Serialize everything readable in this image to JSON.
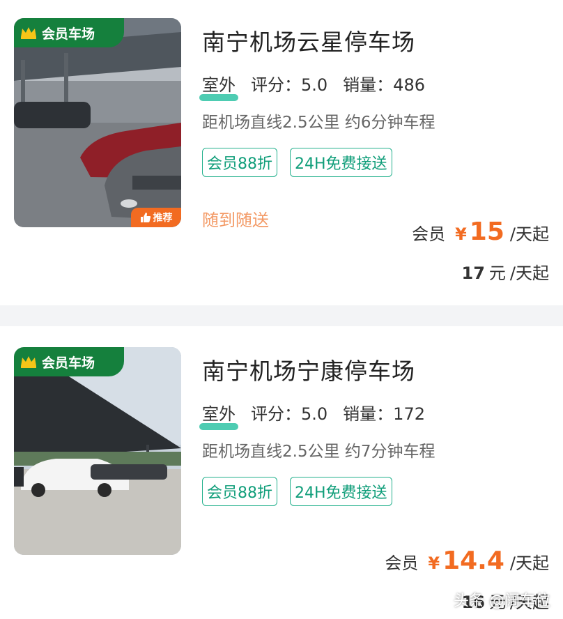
{
  "listings": [
    {
      "badge": "会员车场",
      "recommend": "推荐",
      "name": "南宁机场云星停车场",
      "type": "室外",
      "rating_label": "评分：5.0",
      "sales_label": "销量：486",
      "distance": "距机场直线2.5公里 约6分钟车程",
      "tags": [
        "会员88折",
        "24H免费接送"
      ],
      "service": "随到随送",
      "member_label": "会员",
      "currency": "¥",
      "member_price": "15",
      "price_unit": "/天起",
      "original_price": "17",
      "original_unit": "元",
      "original_suffix": "/天起"
    },
    {
      "badge": "会员车场",
      "name": "南宁机场宁康停车场",
      "type": "室外",
      "rating_label": "评分：5.0",
      "sales_label": "销量：172",
      "distance": "距机场直线2.5公里 约7分钟车程",
      "tags": [
        "会员88折",
        "24H免费接送"
      ],
      "member_label": "会员",
      "currency": "¥",
      "member_price": "14.4",
      "price_unit": "/天起",
      "original_price": "16",
      "original_unit": "元",
      "original_suffix": "/天起"
    }
  ],
  "watermark": "头条 @阔车位",
  "colors": {
    "badge_green": "#15803d",
    "accent_orange": "#f26b21",
    "tag_teal": "#22b08c",
    "service_orange": "#f39a66"
  }
}
